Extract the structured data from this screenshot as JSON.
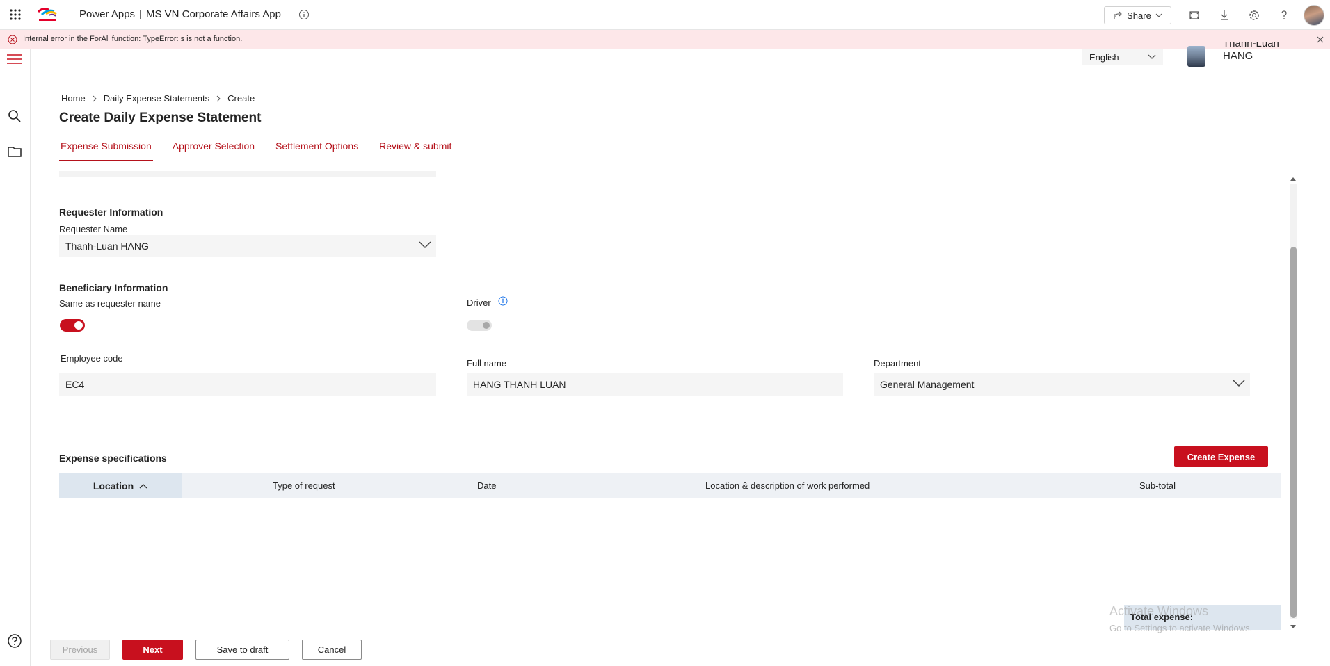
{
  "header": {
    "app_name": "Power Apps",
    "separator": "|",
    "app_title": "MS VN Corporate Affairs App",
    "share_label": "Share"
  },
  "error": {
    "message": "Internal error in the ForAll function: TypeError: s is not a function."
  },
  "language": {
    "selected": "English"
  },
  "user": {
    "first_line": "Thanh-Luan",
    "second_line": "HANG"
  },
  "breadcrumb": {
    "items": [
      "Home",
      "Daily Expense Statements",
      "Create"
    ]
  },
  "page": {
    "title": "Create Daily Expense Statement"
  },
  "tabs": [
    {
      "label": "Expense Submission"
    },
    {
      "label": "Approver Selection"
    },
    {
      "label": "Settlement Options"
    },
    {
      "label": "Review & submit"
    }
  ],
  "requester": {
    "section_title": "Requester Information",
    "name_label": "Requester Name",
    "name_value": "Thanh-Luan HANG"
  },
  "beneficiary": {
    "section_title": "Beneficiary Information",
    "same_as_label": "Same as requester name",
    "same_as_on": true,
    "driver_label": "Driver",
    "driver_on": false,
    "employee_code_label": "Employee code",
    "employee_code_value": "EC4",
    "full_name_label": "Full name",
    "full_name_value": "HANG THANH LUAN",
    "department_label": "Department",
    "department_value": "General Management"
  },
  "expenses": {
    "section_title": "Expense specifications",
    "create_button": "Create Expense",
    "columns": [
      "Location",
      "Type of request",
      "Date",
      "Location & description of work performed",
      "Sub-total"
    ],
    "rows": [],
    "total_label": "Total expense:"
  },
  "watermark": {
    "line1": "Activate Windows",
    "line2": "Go to Settings to activate Windows."
  },
  "footer": {
    "previous": "Previous",
    "next": "Next",
    "save_draft": "Save to draft",
    "cancel": "Cancel"
  },
  "colors": {
    "accent": "#c8101e",
    "error_bg": "#fde7e9"
  }
}
